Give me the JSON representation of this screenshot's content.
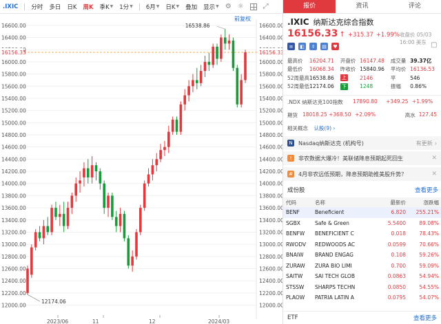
{
  "toolbar": {
    "symbol": ".IXIC",
    "items": [
      "分时",
      "多日",
      "日K",
      "周K",
      "季K",
      "1分",
      "6月",
      "日K",
      "叠加",
      "显示"
    ],
    "active_index": 3
  },
  "chart": {
    "restore_label": "前复权",
    "price_ticks": [
      "16600.00",
      "16400.00",
      "16200.00",
      "16000.00",
      "15800.00",
      "15600.00",
      "15400.00",
      "15200.00",
      "15000.00",
      "14800.00",
      "14600.00",
      "14400.00",
      "14200.00",
      "14000.00",
      "13800.00",
      "13600.00",
      "13400.00",
      "13200.00",
      "13000.00",
      "12800.00",
      "12600.00",
      "12400.00",
      "12200.00",
      "12000.00"
    ],
    "current_price_label": "16156.33",
    "high_annotation": "16538.86",
    "low_annotation": "12174.06",
    "date_labels": [
      "2023/06",
      "11",
      "12",
      "2024/03"
    ]
  },
  "chart_data": {
    "type": "candlestick",
    "title": "",
    "ylim": [
      11950,
      16700
    ],
    "current_price": 16156.33,
    "high": 16538.86,
    "low": 12174.06,
    "candles": [
      {
        "o": 12200,
        "c": 12600,
        "h": 12650,
        "l": 12174
      },
      {
        "o": 12500,
        "c": 12950,
        "h": 13000,
        "l": 12450
      },
      {
        "o": 12950,
        "c": 13200,
        "h": 13250,
        "l": 12900
      },
      {
        "o": 13200,
        "c": 13100,
        "h": 13300,
        "l": 13050
      },
      {
        "o": 13100,
        "c": 13300,
        "h": 13400,
        "l": 13000
      },
      {
        "o": 13300,
        "c": 13200,
        "h": 13450,
        "l": 13150
      },
      {
        "o": 13200,
        "c": 13600,
        "h": 13650,
        "l": 13150
      },
      {
        "o": 13600,
        "c": 13450,
        "h": 13700,
        "l": 13400
      },
      {
        "o": 13450,
        "c": 13500,
        "h": 13650,
        "l": 13300
      },
      {
        "o": 13500,
        "c": 13300,
        "h": 13700,
        "l": 13200
      },
      {
        "o": 13300,
        "c": 13600,
        "h": 13700,
        "l": 13250
      },
      {
        "o": 13600,
        "c": 13800,
        "h": 13850,
        "l": 13500
      },
      {
        "o": 13800,
        "c": 14000,
        "h": 14100,
        "l": 13700
      },
      {
        "o": 14000,
        "c": 14050,
        "h": 14200,
        "l": 13850
      },
      {
        "o": 14100,
        "c": 14250,
        "h": 14350,
        "l": 13950
      },
      {
        "o": 14250,
        "c": 14100,
        "h": 14400,
        "l": 14000
      },
      {
        "o": 14100,
        "c": 14300,
        "h": 14450,
        "l": 14000
      },
      {
        "o": 14300,
        "c": 14200,
        "h": 14350,
        "l": 14050
      },
      {
        "o": 14200,
        "c": 14000,
        "h": 14250,
        "l": 13900
      },
      {
        "o": 14000,
        "c": 13600,
        "h": 14050,
        "l": 13500
      },
      {
        "o": 13600,
        "c": 13800,
        "h": 13850,
        "l": 13450
      },
      {
        "o": 13800,
        "c": 13450,
        "h": 13850,
        "l": 13400
      },
      {
        "o": 13450,
        "c": 13300,
        "h": 13550,
        "l": 13200
      },
      {
        "o": 13300,
        "c": 13500,
        "h": 13600,
        "l": 13200
      },
      {
        "o": 13500,
        "c": 13100,
        "h": 13550,
        "l": 13050
      },
      {
        "o": 13100,
        "c": 12650,
        "h": 13150,
        "l": 12600
      },
      {
        "o": 12650,
        "c": 12800,
        "h": 12900,
        "l": 12550
      },
      {
        "o": 12800,
        "c": 13200,
        "h": 13250,
        "l": 12750
      },
      {
        "o": 13200,
        "c": 13600,
        "h": 13650,
        "l": 13150
      },
      {
        "o": 13600,
        "c": 14000,
        "h": 14050,
        "l": 13550
      },
      {
        "o": 14000,
        "c": 14150,
        "h": 14250,
        "l": 13950
      },
      {
        "o": 14150,
        "c": 14300,
        "h": 14400,
        "l": 14050
      },
      {
        "o": 14300,
        "c": 14400,
        "h": 14500,
        "l": 14200
      },
      {
        "o": 14400,
        "c": 14550,
        "h": 14650,
        "l": 14350
      },
      {
        "o": 14550,
        "c": 14600,
        "h": 14700,
        "l": 14450
      },
      {
        "o": 14600,
        "c": 14850,
        "h": 14950,
        "l": 14500
      },
      {
        "o": 14850,
        "c": 15050,
        "h": 15100,
        "l": 14800
      },
      {
        "o": 15050,
        "c": 14850,
        "h": 15100,
        "l": 14800
      },
      {
        "o": 14850,
        "c": 15300,
        "h": 15350,
        "l": 14800
      },
      {
        "o": 15300,
        "c": 15450,
        "h": 15550,
        "l": 15200
      },
      {
        "o": 15450,
        "c": 15600,
        "h": 15700,
        "l": 15350
      },
      {
        "o": 15600,
        "c": 15700,
        "h": 15800,
        "l": 15500
      },
      {
        "o": 15700,
        "c": 15650,
        "h": 15900,
        "l": 15550
      },
      {
        "o": 15650,
        "c": 15850,
        "h": 15950,
        "l": 15600
      },
      {
        "o": 15850,
        "c": 16000,
        "h": 16100,
        "l": 15750
      },
      {
        "o": 16000,
        "c": 15950,
        "h": 16150,
        "l": 15850
      },
      {
        "o": 15950,
        "c": 16250,
        "h": 16300,
        "l": 15900
      },
      {
        "o": 16250,
        "c": 16050,
        "h": 16300,
        "l": 15950
      },
      {
        "o": 16050,
        "c": 16400,
        "h": 16450,
        "l": 16000
      },
      {
        "o": 16400,
        "c": 16300,
        "h": 16538.86,
        "l": 16200
      },
      {
        "o": 16300,
        "c": 16350,
        "h": 16450,
        "l": 16200
      },
      {
        "o": 16350,
        "c": 15900,
        "h": 16400,
        "l": 15850
      },
      {
        "o": 15900,
        "c": 15300,
        "h": 15950,
        "l": 15250
      },
      {
        "o": 15300,
        "c": 15700,
        "h": 15800,
        "l": 15250
      },
      {
        "o": 15700,
        "c": 16156.33,
        "h": 16200,
        "l": 15650
      }
    ]
  },
  "panel": {
    "tabs": [
      "报价",
      "资讯",
      "评论"
    ],
    "active_tab": 0,
    "code": ".IXIC",
    "name": "纳斯达克综合指数",
    "price": "16156.33",
    "arrow": "↑",
    "change": "+315.37",
    "change_pct": "+1.99%",
    "close_time": "收盘价 05/03 16:00 美东",
    "flag_icons": [
      "us-flag-icon",
      "chart-icon",
      "share-icon",
      "doc-icon",
      "heart-icon"
    ],
    "stats": [
      [
        {
          "l": "最高价",
          "v": "16204.71",
          "c": "red"
        },
        {
          "l": "开盘价",
          "v": "16147.48",
          "c": "red"
        },
        {
          "l": "成交量",
          "v": "39.37亿",
          "c": "black"
        }
      ],
      [
        {
          "l": "最低价",
          "v": "16068.34",
          "c": "red"
        },
        {
          "l": "昨收价",
          "v": "15840.96",
          "c": "black"
        },
        {
          "l": "平均价",
          "v": "16136.53",
          "c": "red"
        }
      ],
      [
        {
          "l": "52周最高",
          "v": "16538.86",
          "c": "black",
          "tag": "上",
          "tagc": "up",
          "tv": "2146",
          "tvc": "red"
        },
        {
          "l": "平",
          "lv": "546",
          "c": "black"
        }
      ],
      [
        {
          "l": "52周最低",
          "v": "12174.06",
          "c": "black",
          "tag": "下",
          "tagc": "down",
          "tv": "1248",
          "tvc": "green"
        },
        {
          "l": "振幅",
          "lv": "0.86%",
          "c": "black"
        }
      ]
    ],
    "ndx": {
      "name": ".NDX 纳斯达克100指数",
      "price": "17890.80",
      "change": "+349.25",
      "pct": "+1.99%"
    },
    "futures": {
      "label": "期货",
      "price": "18018.25",
      "change": "+368.50",
      "pct": "+2.09%",
      "hl_label": "高水",
      "hl_value": "127.45"
    },
    "concept": {
      "label": "相关概念",
      "value": "认股",
      "count": "(9)",
      "arrow": "›"
    },
    "news_header": {
      "text": "Nasdaq纳斯达克 (机构号)",
      "more": "有更新",
      "chev": "›"
    },
    "news": [
      {
        "text": "非农数据大爆冷！美联储降息预期起死回生",
        "close": "✕"
      },
      {
        "text": "4月非农远低预期，降息预期助推美股升势？",
        "close": "✕"
      }
    ],
    "constituents": {
      "title": "成份股",
      "more": "查看更多",
      "headers": [
        "代码",
        "名称",
        "最新价",
        "涨跌幅"
      ],
      "rows": [
        {
          "code": "BENF",
          "name": "Beneficient",
          "price": "6.820",
          "pct": "255.21%"
        },
        {
          "code": "SGBX",
          "name": "Safe & Green",
          "price": "5.5400",
          "pct": "89.08%"
        },
        {
          "code": "BENFW",
          "name": "BENEFICIENT C",
          "price": "0.018",
          "pct": "78.43%"
        },
        {
          "code": "RWODV",
          "name": "REDWOODS AC",
          "price": "0.0599",
          "pct": "70.66%"
        },
        {
          "code": "BNAIW",
          "name": "BRAND ENGAG",
          "price": "0.108",
          "pct": "59.26%"
        },
        {
          "code": "ZURAW",
          "name": "ZURA BIO LIMI",
          "price": "0.700",
          "pct": "59.09%"
        },
        {
          "code": "SAITW",
          "name": "SAI TECH GLOB",
          "price": "0.0863",
          "pct": "54.94%"
        },
        {
          "code": "STSSW",
          "name": "SHARPS TECHN",
          "price": "0.0850",
          "pct": "54.55%"
        },
        {
          "code": "PLAOW",
          "name": "PATRIA LATIN A",
          "price": "0.0795",
          "pct": "54.07%"
        }
      ]
    },
    "etf": {
      "label": "ETF",
      "more": "查看更多"
    }
  },
  "colors": {
    "up": "#e0393e",
    "down": "#1a9b3b",
    "accent": "#1f6ed4"
  }
}
